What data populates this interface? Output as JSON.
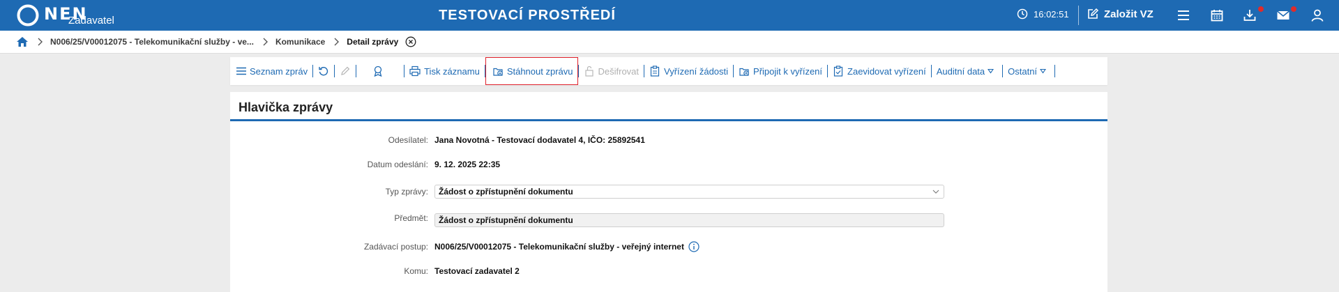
{
  "app": {
    "logo_text": "NEN",
    "logo_sub": "Zadavatel",
    "environment_title": "TESTOVACÍ PROSTŘEDÍ",
    "clock": "16:02:51",
    "create_label": "Založit VZ",
    "brand_color": "#1e6ab3",
    "notification_color": "#e02b2b"
  },
  "top_icons": [
    "menu-icon",
    "calendar-icon",
    "download-icon",
    "mail-icon",
    "user-icon"
  ],
  "breadcrumb": {
    "items": [
      "N006/25/V00012075 - Telekomunikační služby - ve...",
      "Komunikace"
    ],
    "current": "Detail zprávy"
  },
  "toolbar": {
    "list": "Seznam zpráv",
    "print": "Tisk záznamu",
    "download": "Stáhnout zprávu",
    "decrypt": "Dešifrovat",
    "handle_request": "Vyřízení žádosti",
    "attach": "Připojit k vyřízení",
    "register": "Zaevidovat vyřízení",
    "audit": "Auditní data",
    "other": "Ostatní"
  },
  "header": {
    "title": "Hlavička zprávy",
    "fields": {
      "sender_label": "Odesílatel:",
      "sender_value": "Jana Novotná - Testovací dodavatel 4, IČO: 25892541",
      "date_label": "Datum odeslání:",
      "date_value": "9. 12. 2025 22:35",
      "type_label": "Typ zprávy:",
      "type_value": "Žádost o zpřístupnění dokumentu",
      "subject_label": "Předmět:",
      "subject_value": "Žádost o zpřístupnění dokumentu",
      "procedure_label": "Zadávací postup:",
      "procedure_value": "N006/25/V00012075 - Telekomunikační služby - veřejný internet",
      "recipient_label": "Komu:",
      "recipient_value": "Testovací zadavatel 2"
    }
  }
}
